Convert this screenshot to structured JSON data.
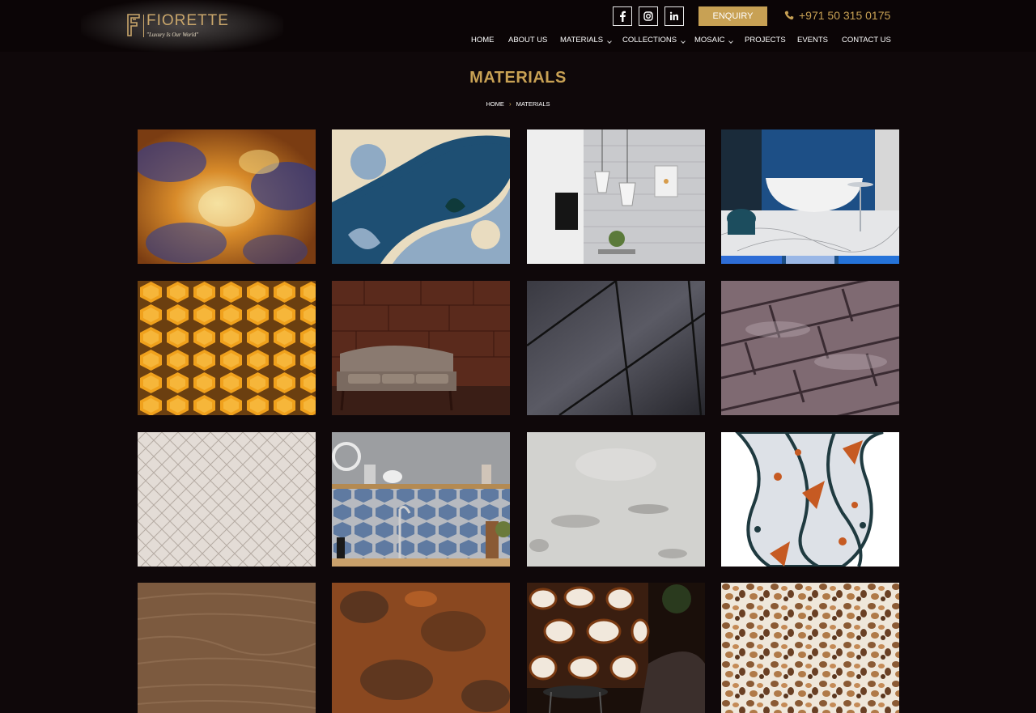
{
  "brand": {
    "name": "FIORETTE",
    "tagline": "\"Luxury Is Our World\"",
    "gold": "#c8a154"
  },
  "header": {
    "social": [
      {
        "name": "facebook-icon"
      },
      {
        "name": "instagram-icon"
      },
      {
        "name": "linkedin-icon"
      }
    ],
    "enquiry_label": "ENQUIRY",
    "phone": "+971 50 315 0175"
  },
  "nav": [
    {
      "label": "HOME",
      "dropdown": false
    },
    {
      "label": "ABOUT US",
      "dropdown": false
    },
    {
      "label": "MATERIALS",
      "dropdown": true
    },
    {
      "label": "COLLECTIONS",
      "dropdown": true
    },
    {
      "label": "MOSAIC",
      "dropdown": true
    },
    {
      "label": "PROJECTS",
      "dropdown": false
    },
    {
      "label": "EVENTS",
      "dropdown": false
    },
    {
      "label": "CONTACT US",
      "dropdown": false
    }
  ],
  "page": {
    "title": "MATERIALS",
    "breadcrumb": [
      "HOME",
      "MATERIALS"
    ]
  }
}
